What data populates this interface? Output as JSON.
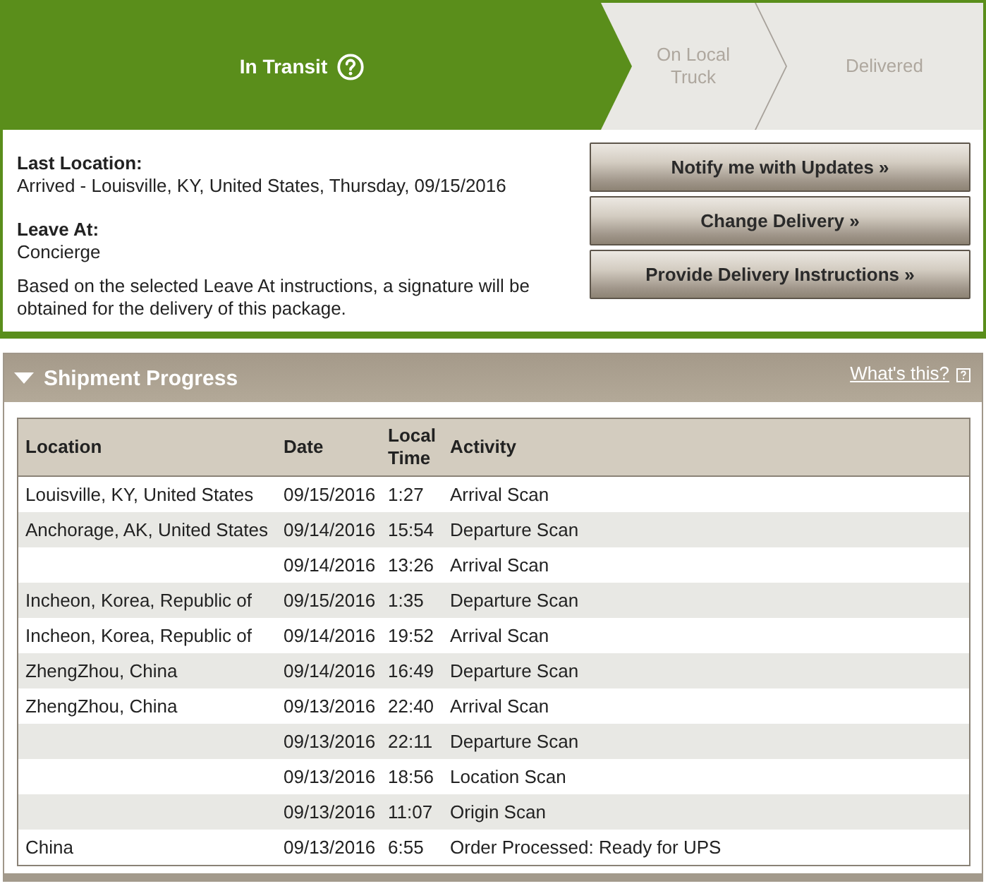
{
  "tracker": {
    "steps": [
      {
        "label": "In Transit",
        "current": true
      },
      {
        "label": "On Local Truck",
        "current": false
      },
      {
        "label": "Delivered",
        "current": false
      }
    ]
  },
  "summary": {
    "fields": [
      {
        "label": "Last Location:",
        "value": "Arrived - Louisville, KY, United States, Thursday, 09/15/2016"
      },
      {
        "label": "Leave At:",
        "value": "Concierge"
      }
    ],
    "note": "Based on the selected Leave At instructions, a signature will be obtained for the delivery of this package."
  },
  "actions": [
    "Notify me with Updates »",
    "Change Delivery »",
    "Provide Delivery Instructions »"
  ],
  "shipment_progress": {
    "title": "Shipment Progress",
    "expanded": true,
    "help_link": "What's this?",
    "table": {
      "columns": [
        "Location",
        "Date",
        "Local Time",
        "Activity"
      ],
      "rows": [
        {
          "location": "Louisville, KY, United States",
          "date": "09/15/2016",
          "local_time": "1:27",
          "activity": "Arrival Scan"
        },
        {
          "location": "Anchorage, AK, United States",
          "date": "09/14/2016",
          "local_time": "15:54",
          "activity": "Departure Scan"
        },
        {
          "date": "09/14/2016",
          "local_time": "13:26",
          "activity": "Arrival Scan"
        },
        {
          "location": "Incheon, Korea, Republic of",
          "date": "09/15/2016",
          "local_time": "1:35",
          "activity": "Departure Scan"
        },
        {
          "location": "Incheon, Korea, Republic of",
          "date": "09/14/2016",
          "local_time": "19:52",
          "activity": "Arrival Scan"
        },
        {
          "location": "ZhengZhou, China",
          "date": "09/14/2016",
          "local_time": "16:49",
          "activity": "Departure Scan"
        },
        {
          "location": "ZhengZhou, China",
          "date": "09/13/2016",
          "local_time": "22:40",
          "activity": "Arrival Scan"
        },
        {
          "date": "09/13/2016",
          "local_time": "22:11",
          "activity": "Departure Scan"
        },
        {
          "date": "09/13/2016",
          "local_time": "18:56",
          "activity": "Location Scan"
        },
        {
          "date": "09/13/2016",
          "local_time": "11:07",
          "activity": "Origin Scan"
        },
        {
          "location": "China",
          "date": "09/13/2016",
          "local_time": "6:55",
          "activity": "Order Processed: Ready for UPS"
        }
      ]
    }
  }
}
